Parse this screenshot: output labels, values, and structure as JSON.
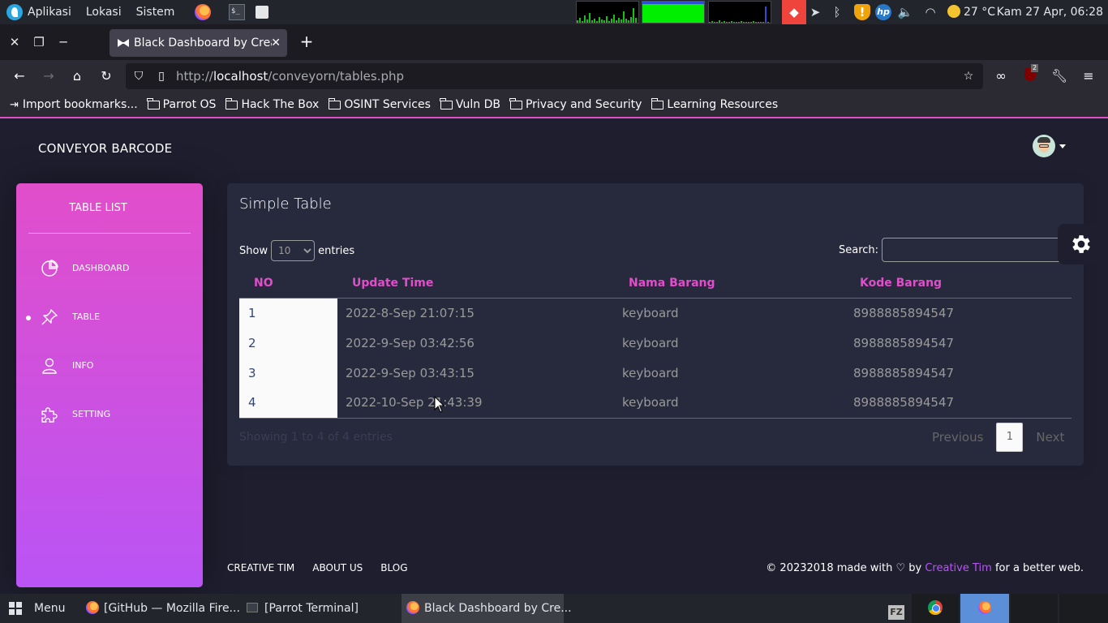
{
  "system_panel": {
    "apps_label": "Aplikasi",
    "places_label": "Lokasi",
    "system_label": "Sistem",
    "temperature": "27 °C",
    "datetime": "Kam 27 Apr, 06:28"
  },
  "browser": {
    "tab_title": "Black Dashboard by Creative Tim",
    "url_prefix": "http://",
    "url_host": "localhost",
    "url_path": "/conveyorn/tables.php",
    "addon_badge": "2",
    "bookmarks": [
      {
        "label": "Import bookmarks...",
        "type": "import"
      },
      {
        "label": "Parrot OS",
        "type": "folder"
      },
      {
        "label": "Hack The Box",
        "type": "folder"
      },
      {
        "label": "OSINT Services",
        "type": "folder"
      },
      {
        "label": "Vuln DB",
        "type": "folder"
      },
      {
        "label": "Privacy and Security",
        "type": "folder"
      },
      {
        "label": "Learning Resources",
        "type": "folder"
      }
    ]
  },
  "page": {
    "brand": "CONVEYOR BARCODE",
    "sidebar": {
      "logo": "TABLE LIST",
      "items": [
        {
          "label": "DASHBOARD",
          "icon": "pie-chart-icon",
          "active": false
        },
        {
          "label": "TABLE",
          "icon": "pin-icon",
          "active": true
        },
        {
          "label": "INFO",
          "icon": "user-icon",
          "active": false
        },
        {
          "label": "SETTING",
          "icon": "puzzle-icon",
          "active": false
        }
      ]
    },
    "card": {
      "title": "Simple Table",
      "show_label": "Show",
      "entries_label": "entries",
      "length_value": "10",
      "search_label": "Search:",
      "columns": [
        "NO",
        "Update Time",
        "Nama Barang",
        "Kode Barang"
      ],
      "rows": [
        [
          "1",
          "2022-8-Sep 21:07:15",
          "keyboard",
          "8988885894547"
        ],
        [
          "2",
          "2022-9-Sep 03:42:56",
          "keyboard",
          "8988885894547"
        ],
        [
          "3",
          "2022-9-Sep 03:43:15",
          "keyboard",
          "8988885894547"
        ],
        [
          "4",
          "2022-10-Sep 21:43:39",
          "keyboard",
          "8988885894547"
        ]
      ],
      "info": "Showing 1 to 4 of 4 entries",
      "pager": {
        "previous": "Previous",
        "page": "1",
        "next": "Next"
      }
    },
    "footer": {
      "links": [
        "CREATIVE TIM",
        "ABOUT US",
        "BLOG"
      ],
      "copyright_prefix": "© 20232018 made with",
      "copyright_by": "by",
      "copyright_brand": "Creative Tim",
      "copyright_suffix": "for a better web."
    }
  },
  "taskbar": {
    "menu_label": "Menu",
    "windows": [
      {
        "label": "[GitHub — Mozilla Fire...",
        "active": false
      },
      {
        "label": "[Parrot Terminal]",
        "active": false
      },
      {
        "label": "Black Dashboard by Cre...",
        "active": true
      }
    ]
  },
  "colors": {
    "accent": "#e14eca",
    "accent2": "#ba54f5",
    "background": "#1e1e2f",
    "card": "#27293d"
  }
}
